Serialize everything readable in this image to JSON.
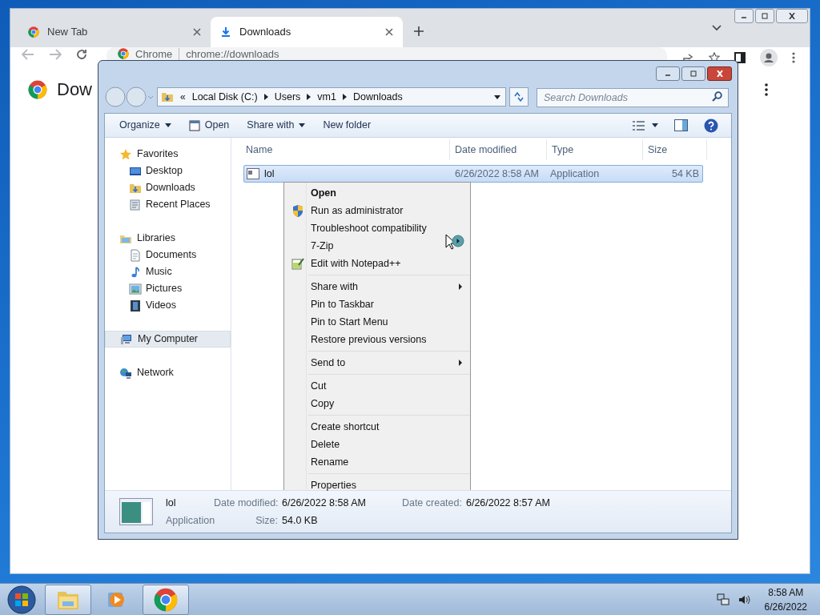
{
  "browser": {
    "tabs": [
      {
        "label": "New Tab",
        "selected": false
      },
      {
        "label": "Downloads",
        "selected": true
      }
    ],
    "omnibox": {
      "site": "Chrome",
      "url": "chrome://downloads"
    },
    "page_title": "Dow"
  },
  "explorer": {
    "overflow": "«",
    "breadcrumb": [
      "Local Disk (C:)",
      "Users",
      "vm1",
      "Downloads"
    ],
    "search": {
      "placeholder": "Search Downloads"
    },
    "toolbar": [
      {
        "label": "Organize",
        "kind": "menu"
      },
      {
        "label": "Open",
        "kind": "open"
      },
      {
        "label": "Share with",
        "kind": "menu"
      },
      {
        "label": "New folder",
        "kind": "action"
      }
    ],
    "nav": [
      {
        "label": "Favorites",
        "kind": "star",
        "selected": false,
        "children": [
          {
            "label": "Desktop",
            "kind": "desktop",
            "selected": false
          },
          {
            "label": "Downloads",
            "kind": "downloads",
            "selected": false
          },
          {
            "label": "Recent Places",
            "kind": "recent",
            "selected": false
          }
        ]
      },
      {
        "label": "Libraries",
        "kind": "library",
        "selected": false,
        "children": [
          {
            "label": "Documents",
            "kind": "document",
            "selected": false
          },
          {
            "label": "Music",
            "kind": "music",
            "selected": false
          },
          {
            "label": "Pictures",
            "kind": "pictures",
            "selected": false
          },
          {
            "label": "Videos",
            "kind": "videos",
            "selected": false
          }
        ]
      },
      {
        "label": "My Computer",
        "kind": "computer",
        "selected": true
      },
      {
        "label": "Network",
        "kind": "network",
        "selected": false
      }
    ],
    "columns": [
      "Name",
      "Date modified",
      "Type",
      "Size"
    ],
    "files": [
      {
        "name": "lol",
        "date": "6/26/2022 8:58 AM",
        "type": "Application",
        "size": "54 KB",
        "selected": true
      }
    ],
    "context_menu": [
      [
        {
          "label": "Open",
          "kind": "text",
          "default": true,
          "submenu": false
        },
        {
          "label": "Run as administrator",
          "kind": "shield",
          "default": false,
          "submenu": false
        },
        {
          "label": "Troubleshoot compatibility",
          "kind": "text",
          "default": false,
          "submenu": false
        },
        {
          "label": "7-Zip",
          "kind": "text",
          "default": false,
          "submenu": false
        },
        {
          "label": "Edit with Notepad++",
          "kind": "notepad",
          "default": false,
          "submenu": false
        }
      ],
      [
        {
          "label": "Share with",
          "kind": "text",
          "default": false,
          "submenu": true
        },
        {
          "label": "Pin to Taskbar",
          "kind": "text",
          "default": false,
          "submenu": false
        },
        {
          "label": "Pin to Start Menu",
          "kind": "text",
          "default": false,
          "submenu": false
        },
        {
          "label": "Restore previous versions",
          "kind": "text",
          "default": false,
          "submenu": false
        }
      ],
      [
        {
          "label": "Send to",
          "kind": "text",
          "default": false,
          "submenu": true
        }
      ],
      [
        {
          "label": "Cut",
          "kind": "text",
          "default": false,
          "submenu": false
        },
        {
          "label": "Copy",
          "kind": "text",
          "default": false,
          "submenu": false
        }
      ],
      [
        {
          "label": "Create shortcut",
          "kind": "text",
          "default": false,
          "submenu": false
        },
        {
          "label": "Delete",
          "kind": "text",
          "default": false,
          "submenu": false
        },
        {
          "label": "Rename",
          "kind": "text",
          "default": false,
          "submenu": false
        }
      ],
      [
        {
          "label": "Properties",
          "kind": "text",
          "default": false,
          "submenu": false
        }
      ]
    ],
    "details": {
      "name": "lol",
      "type": "Application",
      "fields": [
        {
          "label": "Date modified:",
          "value": "6/26/2022 8:58 AM"
        },
        {
          "label": "Size:",
          "value": "54.0 KB"
        },
        {
          "label": "Date created:",
          "value": "6/26/2022 8:57 AM"
        }
      ]
    }
  },
  "taskbar": {
    "apps": [
      {
        "kind": "explorer",
        "running": true
      },
      {
        "kind": "media",
        "running": false
      },
      {
        "kind": "chrome",
        "running": true
      }
    ],
    "clock": {
      "time": "8:58 AM",
      "date": "6/26/2022"
    }
  }
}
